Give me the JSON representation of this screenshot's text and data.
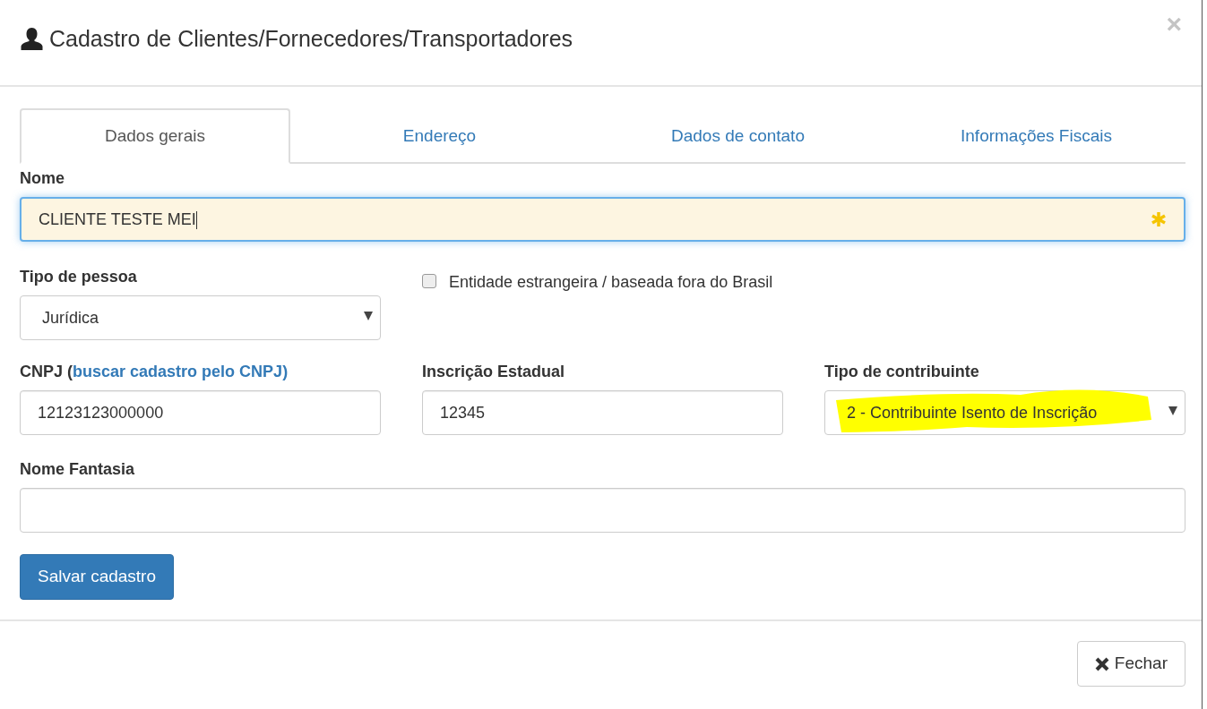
{
  "modal": {
    "title": "Cadastro de Clientes/Fornecedores/Transportadores",
    "close": "×"
  },
  "tabs": [
    {
      "label": "Dados gerais",
      "selected": true
    },
    {
      "label": "Endereço",
      "selected": false
    },
    {
      "label": "Dados de contato",
      "selected": false
    },
    {
      "label": "Informações Fiscais",
      "selected": false
    }
  ],
  "nome": {
    "label": "Nome",
    "value": "CLIENTE TESTE MEI",
    "focused": true,
    "required": true
  },
  "tipo_pessoa": {
    "label": "Tipo de pessoa",
    "value": "Jurídica"
  },
  "estrangeira": {
    "label": "Entidade estrangeira / baseada fora do Brasil",
    "checked": false
  },
  "cnpj": {
    "label": "CNPJ",
    "open": "(",
    "close": ")",
    "link": "buscar cadastro pelo CNPJ",
    "value": "12123123000000"
  },
  "inscricao": {
    "label": "Inscrição Estadual",
    "value": "12345"
  },
  "contribuinte": {
    "label": "Tipo de contribuinte",
    "value": "2 - Contribuinte Isento de Inscrição",
    "highlighted": true
  },
  "fantasia": {
    "label": "Nome Fantasia"
  },
  "save_button": "Salvar cadastro",
  "close_button": "Fechar"
}
